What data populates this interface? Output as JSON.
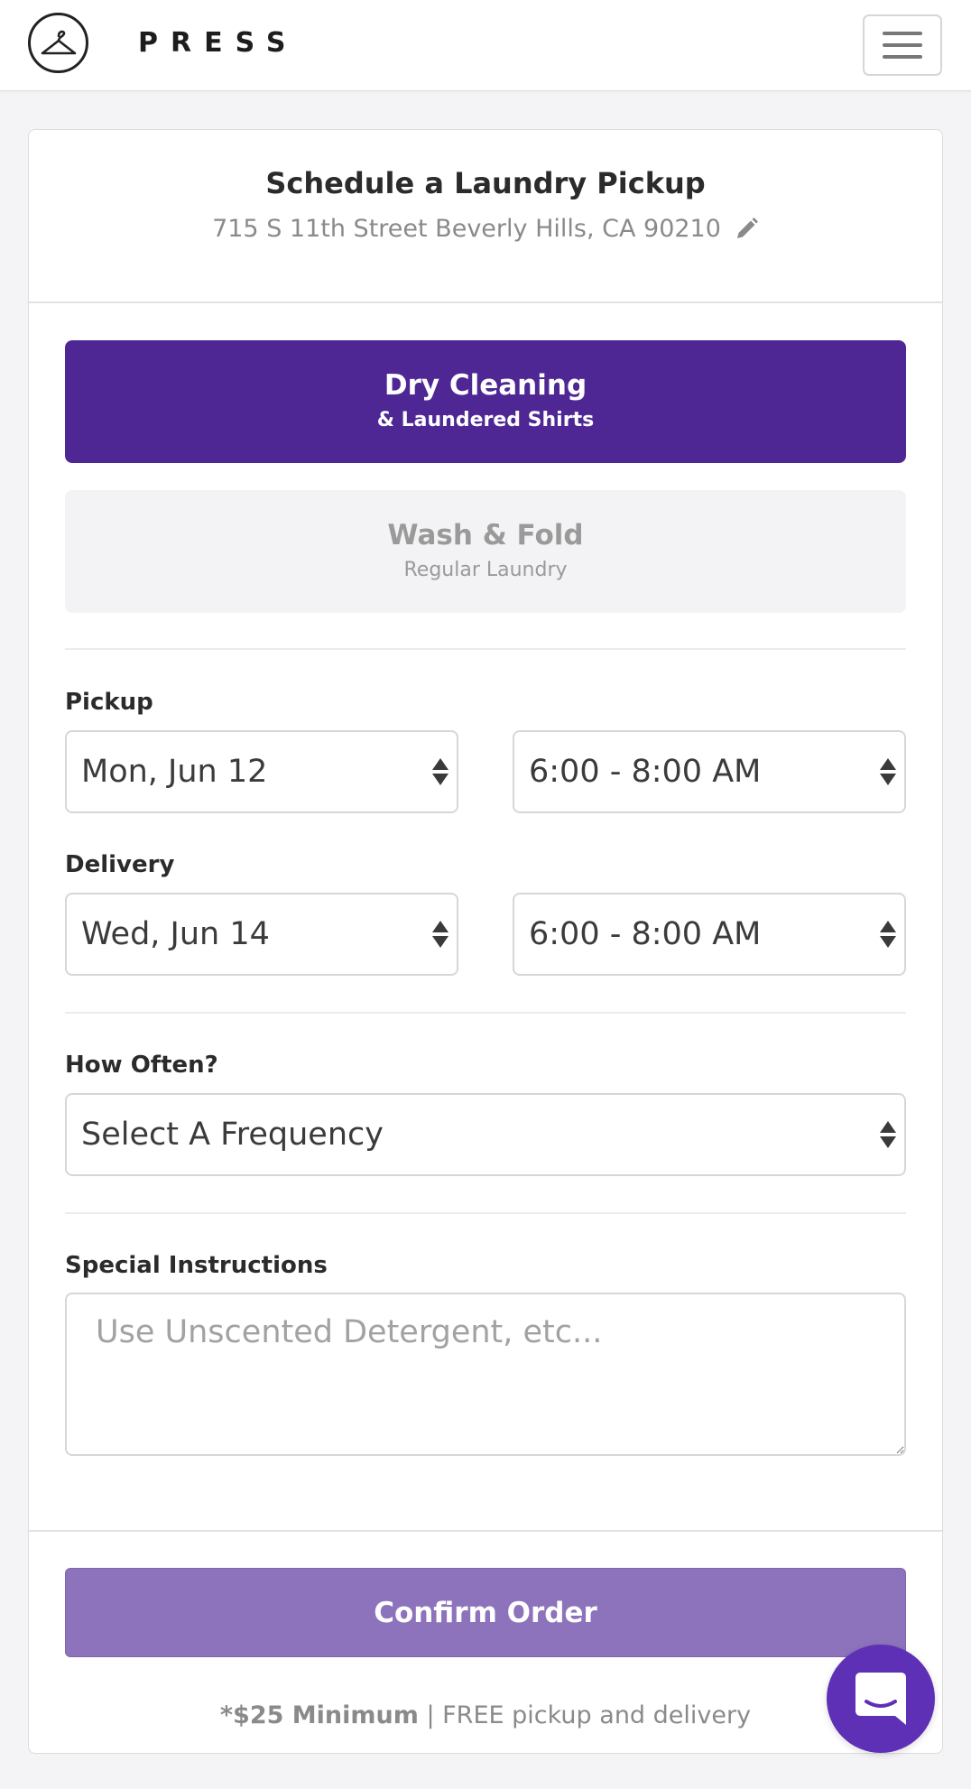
{
  "navbar": {
    "brand": "PRESS",
    "logo_icon": "hanger-icon",
    "menu_icon": "hamburger-menu-icon"
  },
  "header": {
    "title": "Schedule a Laundry Pickup",
    "address": "715 S 11th Street Beverly Hills, CA 90210",
    "edit_icon": "pencil-icon"
  },
  "services": [
    {
      "title": "Dry Cleaning",
      "subtitle": "& Laundered Shirts",
      "selected": true
    },
    {
      "title": "Wash & Fold",
      "subtitle": "Regular Laundry",
      "selected": false
    }
  ],
  "pickup": {
    "label": "Pickup",
    "date": "Mon, Jun 12",
    "time": "6:00 - 8:00 AM"
  },
  "delivery": {
    "label": "Delivery",
    "date": "Wed, Jun 14",
    "time": "6:00 - 8:00 AM"
  },
  "frequency": {
    "label": "How Often?",
    "value": "Select A Frequency"
  },
  "instructions": {
    "label": "Special Instructions",
    "placeholder": "Use Unscented Detergent, etc..."
  },
  "footer": {
    "confirm_label": "Confirm Order",
    "minimum_strong": "*$25 Minimum",
    "minimum_rest": " | FREE pickup and delivery"
  },
  "chat": {
    "icon": "chat-bubble-icon"
  },
  "colors": {
    "brand_purple": "#4e2794",
    "confirm_purple": "#8d73bb",
    "chat_purple": "#5d30b5"
  }
}
